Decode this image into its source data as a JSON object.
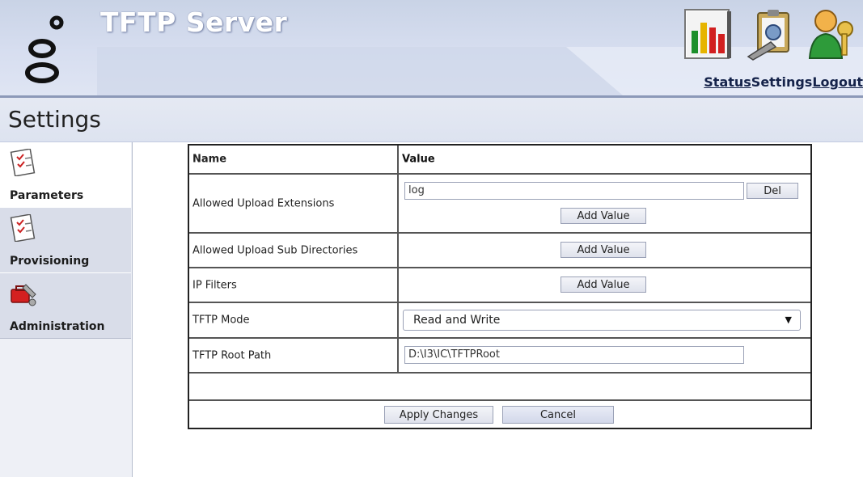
{
  "header": {
    "app_title": "TFTP Server",
    "icons": [
      "status-chart-icon",
      "settings-clipboard-icon",
      "logout-user-key-icon"
    ],
    "links": {
      "status": "Status",
      "settings": "Settings",
      "logout": "Logout"
    }
  },
  "page": {
    "title": "Settings"
  },
  "sidebar": {
    "items": [
      {
        "label": "Parameters",
        "icon": "parameters-checklist-icon",
        "active": true
      },
      {
        "label": "Provisioning",
        "icon": "provisioning-checklist-icon",
        "active": false
      },
      {
        "label": "Administration",
        "icon": "administration-toolbox-icon",
        "active": false
      }
    ]
  },
  "table": {
    "headers": {
      "name": "Name",
      "value": "Value"
    },
    "rows": [
      {
        "name": "Allowed Upload Extensions",
        "value": "log",
        "del_label": "Del",
        "add_label": "Add Value"
      },
      {
        "name": "Allowed Upload Sub Directories",
        "add_label": "Add Value"
      },
      {
        "name": "IP Filters",
        "add_label": "Add Value"
      },
      {
        "name": "TFTP Mode",
        "value": "Read and Write"
      },
      {
        "name": "TFTP Root Path",
        "value": "D:\\I3\\IC\\TFTPRoot"
      }
    ],
    "apply_label": "Apply Changes",
    "cancel_label": "Cancel"
  },
  "colors": {
    "header_bg": "#d7def0",
    "title_white": "#ffffff",
    "link_navy": "#15234a",
    "sidebar_bg": "#d9dde9"
  }
}
